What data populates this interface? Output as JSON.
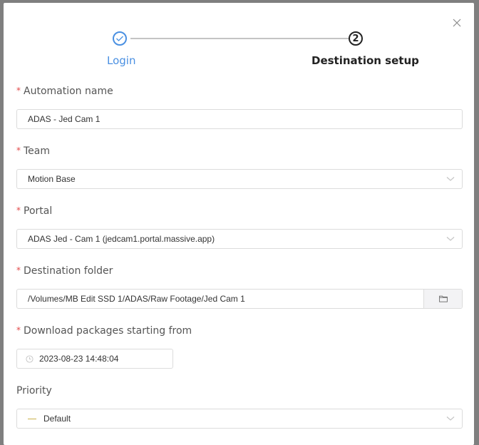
{
  "dialog": {
    "close_icon": "close-icon"
  },
  "steps": [
    {
      "label": "Login",
      "status": "done",
      "icon": "check-icon"
    },
    {
      "label": "Destination setup",
      "status": "active",
      "number": "2"
    }
  ],
  "form": {
    "automation_name": {
      "label": "Automation name",
      "required": true,
      "value": "ADAS - Jed Cam 1"
    },
    "team": {
      "label": "Team",
      "required": true,
      "value": "Motion Base"
    },
    "portal": {
      "label": "Portal",
      "required": true,
      "value": "ADAS Jed - Cam 1 (jedcam1.portal.massive.app)"
    },
    "destination_folder": {
      "label": "Destination folder",
      "required": true,
      "value": "/Volumes/MB Edit SSD 1/ADAS/Raw Footage/Jed Cam 1",
      "button_icon": "folder-icon"
    },
    "download_from": {
      "label": "Download packages starting from",
      "required": true,
      "value": "2023-08-23 14:48:04",
      "icon": "clock-icon"
    },
    "priority": {
      "label": "Priority",
      "required": false,
      "value": "Default"
    }
  },
  "colors": {
    "accent": "#4a90e2",
    "required": "#e24a4a",
    "priority_default": "#c9b14b"
  },
  "required_marker": "*"
}
